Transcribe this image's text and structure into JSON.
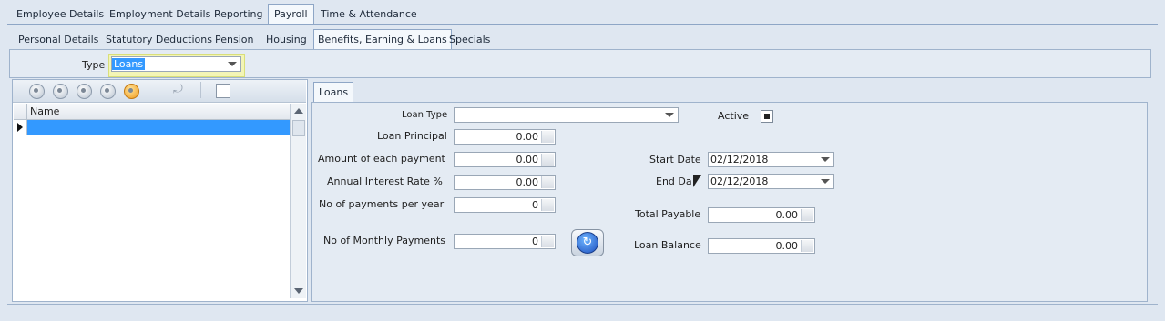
{
  "main_tabs": [
    "Employee Details",
    "Employment Details",
    "Reporting",
    "Payroll",
    "Time & Attendance"
  ],
  "sub_tabs": [
    "Personal Details",
    "Statutory Deductions",
    "Pension",
    "Housing",
    "Benefits, Earning & Loans",
    "Specials"
  ],
  "type_filter": {
    "label": "Type",
    "value": "Loans"
  },
  "grid": {
    "column_header": "Name"
  },
  "detail_tab": "Loans",
  "form": {
    "loan_type_label": "Loan Type",
    "loan_type_value": "",
    "active_label": "Active",
    "loan_principal_label": "Loan Principal",
    "loan_principal_value": "0.00",
    "amount_each_payment_label": "Amount of each payment",
    "amount_each_payment_value": "0.00",
    "annual_interest_label": "Annual Interest Rate %",
    "annual_interest_value": "0.00",
    "payments_per_year_label": "No of payments per year",
    "payments_per_year_value": "0",
    "monthly_payments_label": "No of Monthly Payments",
    "monthly_payments_value": "0",
    "start_date_label": "Start Date",
    "start_date_value": "02/12/2018",
    "end_date_label": "End Da",
    "end_date_value": "02/12/2018",
    "total_payable_label": "Total Payable",
    "total_payable_value": "0.00",
    "loan_balance_label": "Loan Balance",
    "loan_balance_value": "0.00"
  },
  "colors": {
    "selection": "#3399ff",
    "active_tab_bg": "#f4f8fc",
    "panel_bg": "#dfe7f1"
  }
}
